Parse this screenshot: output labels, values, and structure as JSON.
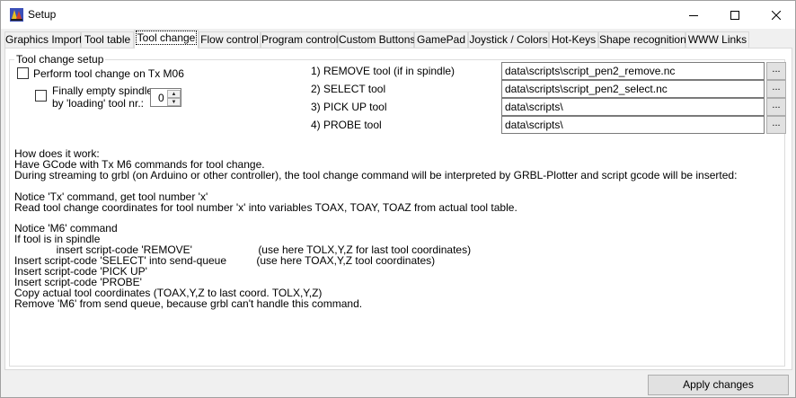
{
  "window": {
    "title": "Setup",
    "minimize_glyph": "—",
    "maximize_glyph": "☐",
    "close_glyph": "✕"
  },
  "tabs": [
    {
      "label": "Graphics Import"
    },
    {
      "label": "Tool table"
    },
    {
      "label": "Tool change",
      "active": true
    },
    {
      "label": "Flow control"
    },
    {
      "label": "Program control"
    },
    {
      "label": "Custom Buttons"
    },
    {
      "label": "GamePad"
    },
    {
      "label": "Joystick / Colors"
    },
    {
      "label": "Hot-Keys"
    },
    {
      "label": "Shape recognition"
    },
    {
      "label": "WWW Links"
    }
  ],
  "tool_change": {
    "group_title": "Tool change setup",
    "perform_checkbox_label": "Perform tool change on Tx M06",
    "perform_checked": false,
    "empty_spindle_label_line1": "Finally empty spindle",
    "empty_spindle_label_line2": "by 'loading' tool nr.:",
    "empty_spindle_checked": false,
    "empty_spindle_tool_nr": "0",
    "scripts": [
      {
        "label": "1) REMOVE tool (if in spindle)",
        "path": "data\\scripts\\script_pen2_remove.nc",
        "browse": "..."
      },
      {
        "label": "2) SELECT tool",
        "path": "data\\scripts\\script_pen2_select.nc",
        "browse": "..."
      },
      {
        "label": "3) PICK UP tool",
        "path": "data\\scripts\\",
        "browse": "..."
      },
      {
        "label": "4) PROBE tool",
        "path": "data\\scripts\\",
        "browse": "..."
      }
    ],
    "help_text": "How does it work:\nHave GCode with Tx M6 commands for tool change.\nDuring streaming to grbl (on Arduino or other controller), the tool change command will be interpreted by GRBL-Plotter and script gcode will be inserted:\n\nNotice 'Tx' command, get tool number 'x'\nRead tool change coordinates for tool number 'x' into variables TOAX, TOAY, TOAZ from actual tool table.\n\nNotice 'M6' command\nIf tool is in spindle\n              insert script-code 'REMOVE'                      (use here TOLX,Y,Z for last tool coordinates)\nInsert script-code 'SELECT' into send-queue          (use here TOAX,Y,Z tool coordinates)\nInsert script-code 'PICK UP'\nInsert script-code 'PROBE'\nCopy actual tool coordinates (TOAX,Y,Z to last coord. TOLX,Y,Z)\nRemove 'M6' from send queue, because grbl can't handle this command."
  },
  "footer": {
    "apply_label": "Apply changes"
  }
}
